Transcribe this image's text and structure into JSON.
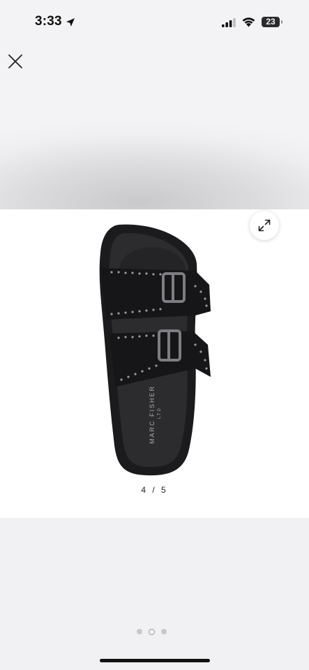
{
  "status_bar": {
    "time": "3:33",
    "battery_level": "23",
    "icons": [
      "location-arrow-icon",
      "cellular-signal-icon",
      "wifi-icon",
      "battery-icon"
    ]
  },
  "viewer": {
    "close_icon": "close-icon",
    "expand_icon": "expand-icon",
    "image": {
      "brand_primary": "MARC FISHER",
      "brand_secondary": "LTD"
    },
    "counter": "4 / 5"
  },
  "pagination": {
    "page_count": 3,
    "active_index": 1
  },
  "colors": {
    "background": "#f2f2f4",
    "card": "#ffffff",
    "sandal": "#1c1c1e",
    "studs": "#9a9a9e"
  }
}
